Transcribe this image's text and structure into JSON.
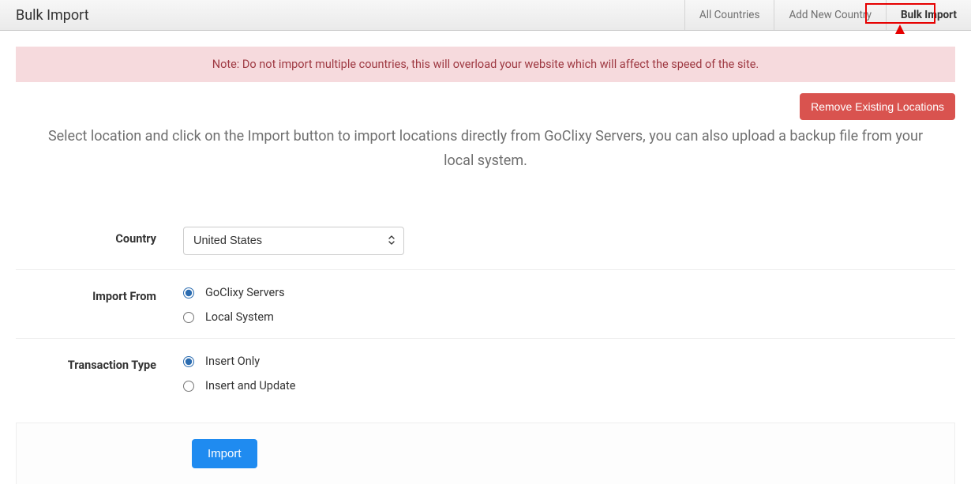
{
  "header": {
    "title": "Bulk Import",
    "nav": {
      "all_countries": "All Countries",
      "add_new_country": "Add New Country",
      "bulk_import": "Bulk Import"
    }
  },
  "alert": {
    "note": "Note: Do not import multiple countries, this will overload your website which will affect the speed of the site."
  },
  "buttons": {
    "remove_existing": "Remove Existing Locations",
    "import": "Import"
  },
  "intro": "Select location and click on the Import button to import locations directly from GoClixy Servers, you can also upload a backup file from your local system.",
  "form": {
    "country": {
      "label": "Country",
      "selected": "United States"
    },
    "import_from": {
      "label": "Import From",
      "options": {
        "goclixy": "GoClixy Servers",
        "local": "Local System"
      }
    },
    "transaction_type": {
      "label": "Transaction Type",
      "options": {
        "insert_only": "Insert Only",
        "insert_update": "Insert and Update"
      }
    }
  }
}
